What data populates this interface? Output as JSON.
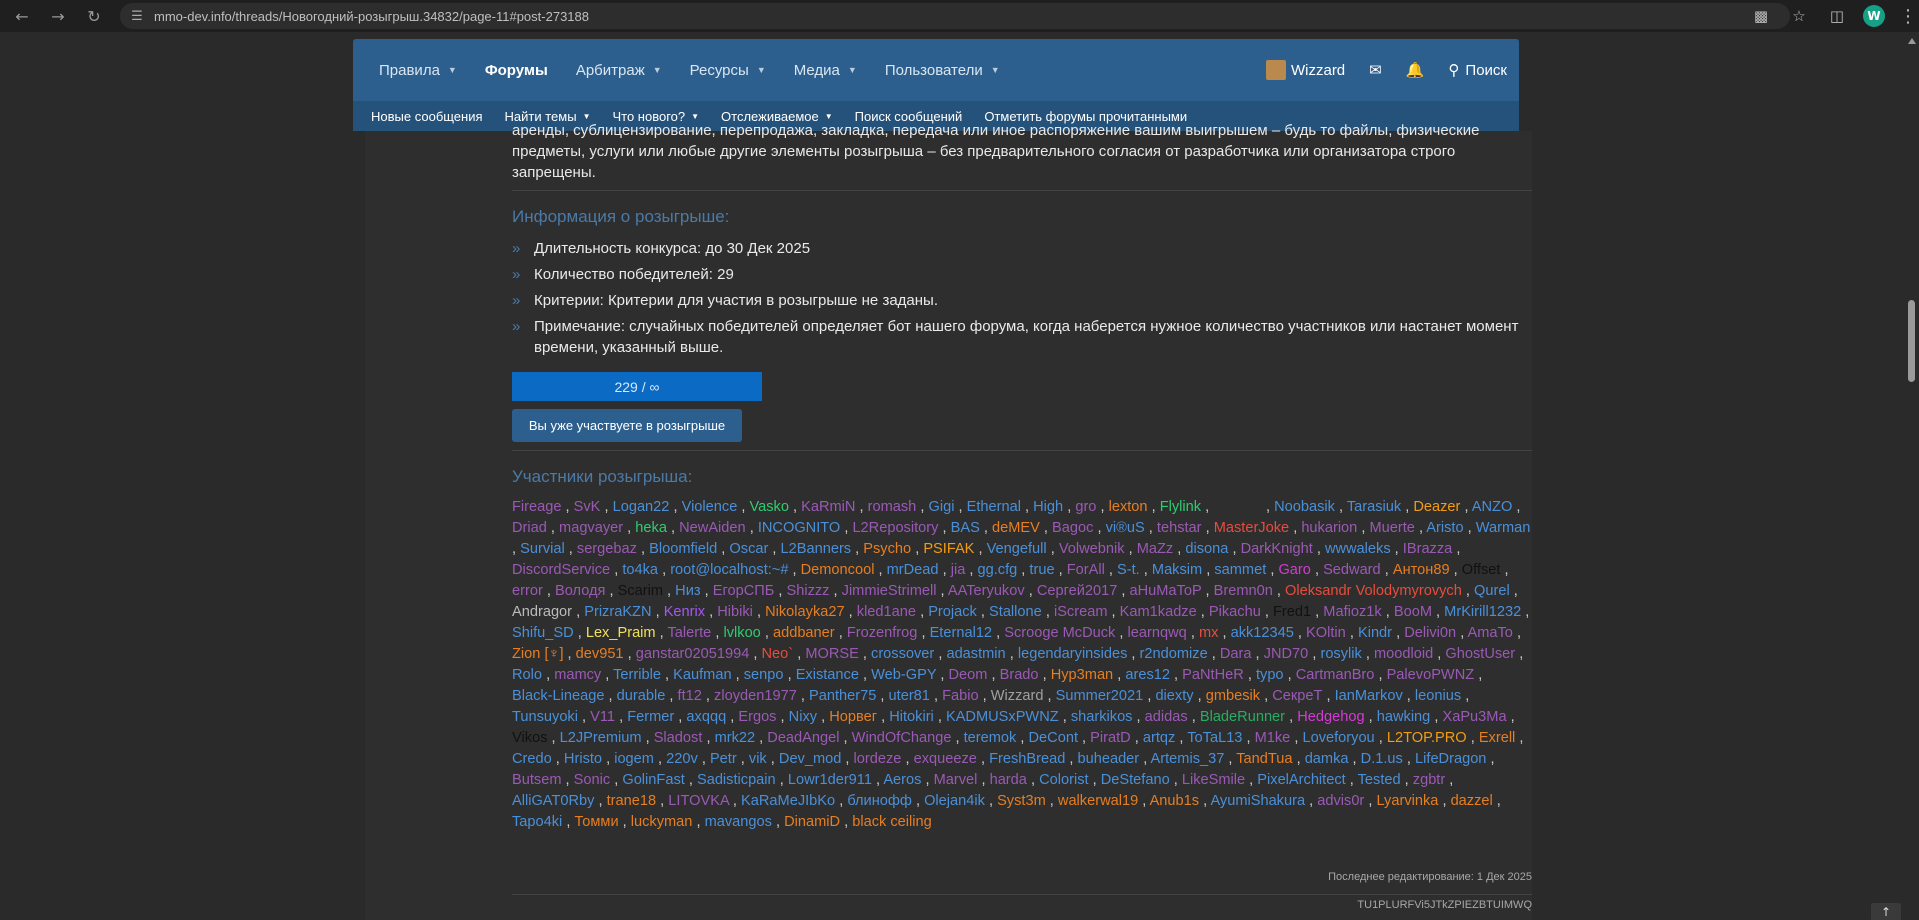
{
  "browser": {
    "url": "mmo-dev.info/threads/Новогодний-розыгрыш.34832/page-11#post-273188",
    "profile_initial": "W"
  },
  "nav": {
    "tabs": [
      {
        "label": "Правила",
        "dropdown": true
      },
      {
        "label": "Форумы",
        "dropdown": false,
        "active": true
      },
      {
        "label": "Арбитраж",
        "dropdown": true
      },
      {
        "label": "Ресурсы",
        "dropdown": true
      },
      {
        "label": "Медиа",
        "dropdown": true
      },
      {
        "label": "Пользователи",
        "dropdown": true
      }
    ],
    "username": "Wizzard",
    "search_label": "Поиск",
    "subnav": [
      {
        "label": "Новые сообщения",
        "dropdown": false
      },
      {
        "label": "Найти темы",
        "dropdown": true
      },
      {
        "label": "Что нового?",
        "dropdown": true
      },
      {
        "label": "Отслеживаемое",
        "dropdown": true
      },
      {
        "label": "Поиск сообщений",
        "dropdown": false
      },
      {
        "label": "Отметить форумы прочитанными",
        "dropdown": false
      }
    ]
  },
  "post": {
    "rules_text": "аренды, сублицензирование, перепродажа, закладка, передача или иное распоряжение вашим выигрышем – будь то файлы, физические предметы, услуги или любые другие элементы розыгрыша – без предварительного согласия от разработчика или организатора строго запрещены.",
    "info_title": "Информация о розыгрыше:",
    "info_items": [
      "Длительность конкурса: до 30 Дек 2025",
      "Количество победителей: 29",
      "Критерии: Критерии для участия в розыгрыше не заданы.",
      "Примечание: случайных победителей определяет бот нашего форума, когда наберется нужное количество участников или настанет момент времени, указанный выше."
    ],
    "progress_label": "229 / ∞",
    "joined_label": "Вы уже участвуете в розыгрыше",
    "participants_title": "Участники розыгрыша:",
    "participants": [
      {
        "n": "Fireage",
        "c": "#9b59b6"
      },
      {
        "n": "SvK",
        "c": "#9b59b6"
      },
      {
        "n": "Logan22",
        "c": "#4a90d9"
      },
      {
        "n": "Violence",
        "c": "#4a90d9"
      },
      {
        "n": "Vasko",
        "c": "#2ecc71"
      },
      {
        "n": "KaRmiN",
        "c": "#9b59b6"
      },
      {
        "n": "romash",
        "c": "#9b59b6"
      },
      {
        "n": "Gigi",
        "c": "#4a90d9"
      },
      {
        "n": "Ethernal",
        "c": "#4a90d9"
      },
      {
        "n": "High",
        "c": "#4a90d9"
      },
      {
        "n": "gro",
        "c": "#9b59b6"
      },
      {
        "n": "lexton",
        "c": "#e67e22"
      },
      {
        "n": "Flylink",
        "c": "#2ecc71"
      },
      {
        "n": "",
        "c": "#2e2e2e"
      },
      {
        "n": "Noobasik",
        "c": "#4a90d9"
      },
      {
        "n": "Tarasiuk",
        "c": "#4a90d9"
      },
      {
        "n": "Deazer",
        "c": "#f39c12"
      },
      {
        "n": "ANZO",
        "c": "#4a90d9"
      },
      {
        "n": "Driad",
        "c": "#9b59b6"
      },
      {
        "n": "magvayer",
        "c": "#9b59b6"
      },
      {
        "n": "heka",
        "c": "#2ecc71"
      },
      {
        "n": "NewAiden",
        "c": "#9b59b6"
      },
      {
        "n": "INCOGNITO",
        "c": "#4a90d9"
      },
      {
        "n": "L2Repository",
        "c": "#9b59b6"
      },
      {
        "n": "BAS",
        "c": "#4a90d9"
      },
      {
        "n": "deMEV",
        "c": "#e67e22"
      },
      {
        "n": "Bagoc",
        "c": "#9b59b6"
      },
      {
        "n": "vi®uS",
        "c": "#4a90d9"
      },
      {
        "n": "tehstar",
        "c": "#9b59b6"
      },
      {
        "n": "MasterJoke",
        "c": "#e74c3c"
      },
      {
        "n": "hukarion",
        "c": "#9b59b6"
      },
      {
        "n": "Muerte",
        "c": "#9b59b6"
      },
      {
        "n": "Aristo",
        "c": "#4a90d9"
      },
      {
        "n": "Warman",
        "c": "#4a90d9"
      },
      {
        "n": "Survial",
        "c": "#4a90d9"
      },
      {
        "n": "sergebaz",
        "c": "#9b59b6"
      },
      {
        "n": "Bloomfield",
        "c": "#4a90d9"
      },
      {
        "n": "Oscar",
        "c": "#4a90d9"
      },
      {
        "n": "L2Banners",
        "c": "#4a90d9"
      },
      {
        "n": "Psycho",
        "c": "#e67e22"
      },
      {
        "n": "PSIFAK",
        "c": "#f39c12"
      },
      {
        "n": "Vengefull",
        "c": "#4a90d9"
      },
      {
        "n": "Volwebnik",
        "c": "#9b59b6"
      },
      {
        "n": "MaZz",
        "c": "#9b59b6"
      },
      {
        "n": "disona",
        "c": "#4a90d9"
      },
      {
        "n": "DarkKnight",
        "c": "#9b59b6"
      },
      {
        "n": "wwwaleks",
        "c": "#4a90d9"
      },
      {
        "n": "IBrazza",
        "c": "#9b59b6"
      },
      {
        "n": "DiscordService",
        "c": "#9b59b6"
      },
      {
        "n": "to4ka",
        "c": "#4a90d9"
      },
      {
        "n": "root@localhost:~#",
        "c": "#4a90d9"
      },
      {
        "n": "Demoncool",
        "c": "#e67e22"
      },
      {
        "n": "mrDead",
        "c": "#4a90d9"
      },
      {
        "n": "jia",
        "c": "#9b59b6"
      },
      {
        "n": "gg.cfg",
        "c": "#4a90d9"
      },
      {
        "n": "true",
        "c": "#4a90d9"
      },
      {
        "n": "ForAll",
        "c": "#9b59b6"
      },
      {
        "n": "S-t.",
        "c": "#4a90d9"
      },
      {
        "n": "Maksim",
        "c": "#4a90d9"
      },
      {
        "n": "sammet",
        "c": "#4a90d9"
      },
      {
        "n": "Garo",
        "c": "#d63ad6"
      },
      {
        "n": "Sedward",
        "c": "#9b59b6"
      },
      {
        "n": "Антон89",
        "c": "#e67e22"
      },
      {
        "n": "Offset",
        "c": "#111111"
      },
      {
        "n": "error",
        "c": "#9b59b6"
      },
      {
        "n": "Володя",
        "c": "#9b59b6"
      },
      {
        "n": "Scarim",
        "c": "#111111"
      },
      {
        "n": "Низ",
        "c": "#4a90d9"
      },
      {
        "n": "ЕгорСПБ",
        "c": "#9b59b6"
      },
      {
        "n": "Shizzz",
        "c": "#9b59b6"
      },
      {
        "n": "JimmieStrimell",
        "c": "#9b59b6"
      },
      {
        "n": "AATeryukov",
        "c": "#9b59b6"
      },
      {
        "n": "Сергей2017",
        "c": "#9b59b6"
      },
      {
        "n": "aHuMaToP",
        "c": "#9b59b6"
      },
      {
        "n": "Bremn0n",
        "c": "#9b59b6"
      },
      {
        "n": "Oleksandr Volodymyrovych",
        "c": "#e74c3c"
      },
      {
        "n": "Qurel",
        "c": "#4a90d9"
      },
      {
        "n": "Andragor",
        "c": "#bbbbbb"
      },
      {
        "n": "PrizraKZN",
        "c": "#4a90d9"
      },
      {
        "n": "Kenrix",
        "c": "#a855f7"
      },
      {
        "n": "Hibiki",
        "c": "#9b59b6"
      },
      {
        "n": "Nikolayka27",
        "c": "#e67e22"
      },
      {
        "n": "kled1ane",
        "c": "#9b59b6"
      },
      {
        "n": "Projack",
        "c": "#4a90d9"
      },
      {
        "n": "Stallone",
        "c": "#4a90d9"
      },
      {
        "n": "iScream",
        "c": "#9b59b6"
      },
      {
        "n": "Kam1kadze",
        "c": "#9b59b6"
      },
      {
        "n": "Pikachu",
        "c": "#9b59b6"
      },
      {
        "n": "Fred1",
        "c": "#111111"
      },
      {
        "n": "Mafioz1k",
        "c": "#9b59b6"
      },
      {
        "n": "BooM",
        "c": "#9b59b6"
      },
      {
        "n": "MrKirill1232",
        "c": "#4a90d9"
      },
      {
        "n": "Shifu_SD",
        "c": "#4a90d9"
      },
      {
        "n": "Lex_Praim",
        "c": "#f1e05a"
      },
      {
        "n": "Talerte",
        "c": "#9b59b6"
      },
      {
        "n": "lvlkoo",
        "c": "#2ecc71"
      },
      {
        "n": "addbaner",
        "c": "#e67e22"
      },
      {
        "n": "Frozenfrog",
        "c": "#9b59b6"
      },
      {
        "n": "Eternal12",
        "c": "#4a90d9"
      },
      {
        "n": "Scrooge McDuck",
        "c": "#9b59b6"
      },
      {
        "n": "learnqwq",
        "c": "#9b59b6"
      },
      {
        "n": "mx",
        "c": "#e74c3c"
      },
      {
        "n": "akk12345",
        "c": "#4a90d9"
      },
      {
        "n": "KOltin",
        "c": "#9b59b6"
      },
      {
        "n": "Kindr",
        "c": "#4a90d9"
      },
      {
        "n": "Delivi0n",
        "c": "#9b59b6"
      },
      {
        "n": "AmaTo",
        "c": "#9b59b6"
      },
      {
        "n": "Zion [♆]",
        "c": "#e67e22"
      },
      {
        "n": "dev951",
        "c": "#e67e22"
      },
      {
        "n": "ganstar02051994",
        "c": "#9b59b6"
      },
      {
        "n": "Neo`",
        "c": "#e74c3c"
      },
      {
        "n": "MORSE",
        "c": "#9b59b6"
      },
      {
        "n": "crossover",
        "c": "#4a90d9"
      },
      {
        "n": "adastmin",
        "c": "#4a90d9"
      },
      {
        "n": "legendaryinsides",
        "c": "#4a90d9"
      },
      {
        "n": "r2ndomize",
        "c": "#4a90d9"
      },
      {
        "n": "Dara",
        "c": "#9b59b6"
      },
      {
        "n": "JND70",
        "c": "#9b59b6"
      },
      {
        "n": "rosylik",
        "c": "#4a90d9"
      },
      {
        "n": "moodloid",
        "c": "#9b59b6"
      },
      {
        "n": "GhostUser",
        "c": "#9b59b6"
      },
      {
        "n": "Rolo",
        "c": "#4a90d9"
      },
      {
        "n": "mamcy",
        "c": "#9b59b6"
      },
      {
        "n": "Terrible",
        "c": "#4a90d9"
      },
      {
        "n": "Kaufman",
        "c": "#4a90d9"
      },
      {
        "n": "senpo",
        "c": "#4a90d9"
      },
      {
        "n": "Existance",
        "c": "#4a90d9"
      },
      {
        "n": "Web-GPY",
        "c": "#4a90d9"
      },
      {
        "n": "Deom",
        "c": "#9b59b6"
      },
      {
        "n": "Brado",
        "c": "#9b59b6"
      },
      {
        "n": "Hyp3man",
        "c": "#e67e22"
      },
      {
        "n": "ares12",
        "c": "#4a90d9"
      },
      {
        "n": "PaNtHeR",
        "c": "#9b59b6"
      },
      {
        "n": "typo",
        "c": "#4a90d9"
      },
      {
        "n": "CartmanBro",
        "c": "#9b59b6"
      },
      {
        "n": "PalevoPWNZ",
        "c": "#9b59b6"
      },
      {
        "n": "Black-Lineage",
        "c": "#4a90d9"
      },
      {
        "n": "durable",
        "c": "#4a90d9"
      },
      {
        "n": "ft12",
        "c": "#9b59b6"
      },
      {
        "n": "zloyden1977",
        "c": "#9b59b6"
      },
      {
        "n": "Panther75",
        "c": "#4a90d9"
      },
      {
        "n": "uter81",
        "c": "#4a90d9"
      },
      {
        "n": "Fabio",
        "c": "#9b59b6"
      },
      {
        "n": "Wizzard",
        "c": "#a0a0a0"
      },
      {
        "n": "Summer2021",
        "c": "#4a90d9"
      },
      {
        "n": "diexty",
        "c": "#4a90d9"
      },
      {
        "n": "gmbesik",
        "c": "#e67e22"
      },
      {
        "n": "СекреТ",
        "c": "#9b59b6"
      },
      {
        "n": "IanMarkov",
        "c": "#4a90d9"
      },
      {
        "n": "leonius",
        "c": "#4a90d9"
      },
      {
        "n": "Tunsuyoki",
        "c": "#4a90d9"
      },
      {
        "n": "V11",
        "c": "#9b59b6"
      },
      {
        "n": "Fermer",
        "c": "#4a90d9"
      },
      {
        "n": "axqqq",
        "c": "#4a90d9"
      },
      {
        "n": "Ergos",
        "c": "#9b59b6"
      },
      {
        "n": "Nixy",
        "c": "#4a90d9"
      },
      {
        "n": "Норвег",
        "c": "#e67e22"
      },
      {
        "n": "Hitokiri",
        "c": "#4a90d9"
      },
      {
        "n": "KADMUSxPWNZ",
        "c": "#4a90d9"
      },
      {
        "n": "sharkikos",
        "c": "#4a90d9"
      },
      {
        "n": "adidas",
        "c": "#9b59b6"
      },
      {
        "n": "BladeRunner",
        "c": "#27ae60"
      },
      {
        "n": "Hedgehog",
        "c": "#d63ad6"
      },
      {
        "n": "hawking",
        "c": "#4a90d9"
      },
      {
        "n": "XaPu3Ma",
        "c": "#9b59b6"
      },
      {
        "n": "Vikos",
        "c": "#111111"
      },
      {
        "n": "L2JPremium",
        "c": "#4a90d9"
      },
      {
        "n": "Sladost",
        "c": "#9b59b6"
      },
      {
        "n": "mrk22",
        "c": "#4a90d9"
      },
      {
        "n": "DeadAngel",
        "c": "#9b59b6"
      },
      {
        "n": "WindOfChange",
        "c": "#9b59b6"
      },
      {
        "n": "teremok",
        "c": "#4a90d9"
      },
      {
        "n": "DeCont",
        "c": "#4a90d9"
      },
      {
        "n": "PiratD",
        "c": "#9b59b6"
      },
      {
        "n": "artqz",
        "c": "#4a90d9"
      },
      {
        "n": "ToTaL13",
        "c": "#4a90d9"
      },
      {
        "n": "M1ke",
        "c": "#9b59b6"
      },
      {
        "n": "Loveforyou",
        "c": "#4a90d9"
      },
      {
        "n": "L2TOP.PRO",
        "c": "#f39c12"
      },
      {
        "n": "Exrell",
        "c": "#e67e22"
      },
      {
        "n": "Credo",
        "c": "#4a90d9"
      },
      {
        "n": "Hristo",
        "c": "#4a90d9"
      },
      {
        "n": "iogem",
        "c": "#4a90d9"
      },
      {
        "n": "220v",
        "c": "#4a90d9"
      },
      {
        "n": "Petr",
        "c": "#4a90d9"
      },
      {
        "n": "vik",
        "c": "#4a90d9"
      },
      {
        "n": "Dev_mod",
        "c": "#4a90d9"
      },
      {
        "n": "lordeze",
        "c": "#9b59b6"
      },
      {
        "n": "exqueeze",
        "c": "#9b59b6"
      },
      {
        "n": "FreshBread",
        "c": "#4a90d9"
      },
      {
        "n": "buheader",
        "c": "#4a90d9"
      },
      {
        "n": "Artemis_37",
        "c": "#4a90d9"
      },
      {
        "n": "TandTua",
        "c": "#e67e22"
      },
      {
        "n": "damka",
        "c": "#4a90d9"
      },
      {
        "n": "D.1.us",
        "c": "#4a90d9"
      },
      {
        "n": "LifeDragon",
        "c": "#4a90d9"
      },
      {
        "n": "Butsem",
        "c": "#9b59b6"
      },
      {
        "n": "Sonic",
        "c": "#9b59b6"
      },
      {
        "n": "GolinFast",
        "c": "#4a90d9"
      },
      {
        "n": "Sadisticpain",
        "c": "#4a90d9"
      },
      {
        "n": "Lowr1der911",
        "c": "#4a90d9"
      },
      {
        "n": "Aeros",
        "c": "#4a90d9"
      },
      {
        "n": "Marvel",
        "c": "#9b59b6"
      },
      {
        "n": "harda",
        "c": "#9b59b6"
      },
      {
        "n": "Colorist",
        "c": "#4a90d9"
      },
      {
        "n": "DeStefano",
        "c": "#4a90d9"
      },
      {
        "n": "LikeSmile",
        "c": "#9b59b6"
      },
      {
        "n": "PixelArchitect",
        "c": "#4a90d9"
      },
      {
        "n": "Tested",
        "c": "#4a90d9"
      },
      {
        "n": "zgbtr",
        "c": "#9b59b6"
      },
      {
        "n": "AlliGAT0Rby",
        "c": "#4a90d9"
      },
      {
        "n": "trane18",
        "c": "#e67e22"
      },
      {
        "n": "LITOVKA",
        "c": "#9b59b6"
      },
      {
        "n": "KaRaMeJIbKo",
        "c": "#4a90d9"
      },
      {
        "n": "блинофф",
        "c": "#4a90d9"
      },
      {
        "n": "Olejan4ik",
        "c": "#4a90d9"
      },
      {
        "n": "Syst3m",
        "c": "#e67e22"
      },
      {
        "n": "walkerwal19",
        "c": "#e67e22"
      },
      {
        "n": "Anub1s",
        "c": "#e67e22"
      },
      {
        "n": "AyumiShakura",
        "c": "#4a90d9"
      },
      {
        "n": "advis0r",
        "c": "#9b59b6"
      },
      {
        "n": "Lyarvinka",
        "c": "#e67e22"
      },
      {
        "n": "dazzel",
        "c": "#e67e22"
      },
      {
        "n": "Tapo4ki",
        "c": "#4a90d9"
      },
      {
        "n": "Томми",
        "c": "#e67e22"
      },
      {
        "n": "luckyman",
        "c": "#e67e22"
      },
      {
        "n": "mavangos",
        "c": "#4a90d9"
      },
      {
        "n": "DinamiD",
        "c": "#e67e22"
      },
      {
        "n": "black ceiling",
        "c": "#e67e22"
      }
    ],
    "edited": "Последнее редактирование: 1 Дек 2025",
    "signature": "TU1PLURFVi5JTkZPIEZBTUIMWQ"
  }
}
